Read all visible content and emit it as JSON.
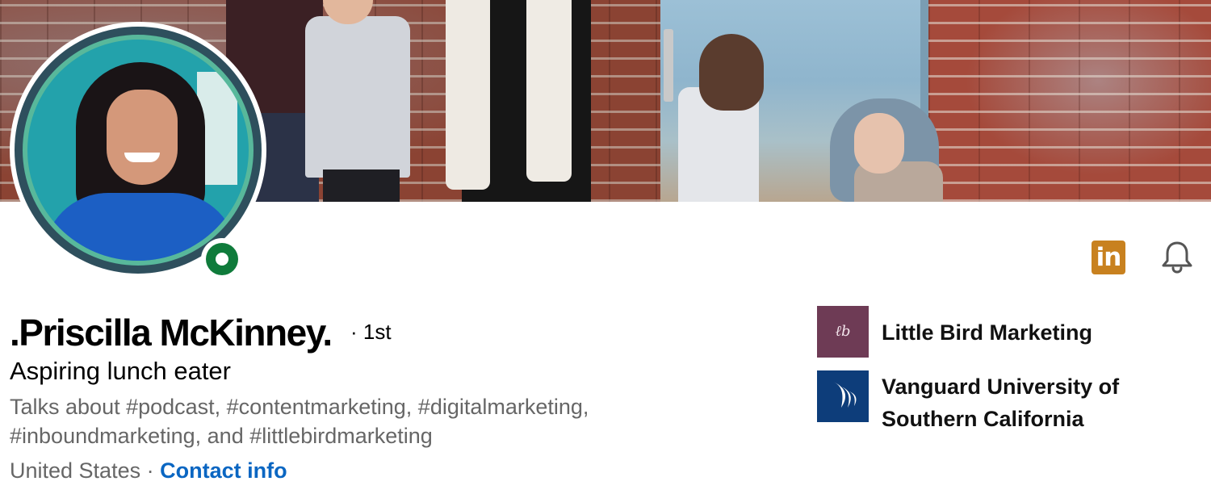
{
  "profile": {
    "name": ".Priscilla McKinney.",
    "degree": "· 1st",
    "headline": "Aspiring lunch eater",
    "talks_about": "Talks about #podcast, #contentmarketing, #digitalmarketing, #inboundmarketing, and #littlebirdmarketing",
    "location": "United States",
    "location_separator": " · ",
    "contact_info_label": "Contact info",
    "online_status": "online"
  },
  "top_actions": {
    "linkedin_badge_text": "in",
    "linkedin_badge_color": "#c8811f",
    "bell_icon": "bell-icon"
  },
  "organizations": [
    {
      "name": "Little Bird Marketing",
      "logo_text": "ℓb",
      "logo_color": "#6e3b55"
    },
    {
      "name": "Vanguard University of Southern California",
      "logo_icon": "vanguard-flame-icon",
      "logo_color": "#0d3d7a"
    }
  ],
  "colors": {
    "link": "#0a66c2",
    "secondary_text": "#666666",
    "online_green": "#0f7b3b",
    "avatar_ring": "#2e4f5d"
  }
}
